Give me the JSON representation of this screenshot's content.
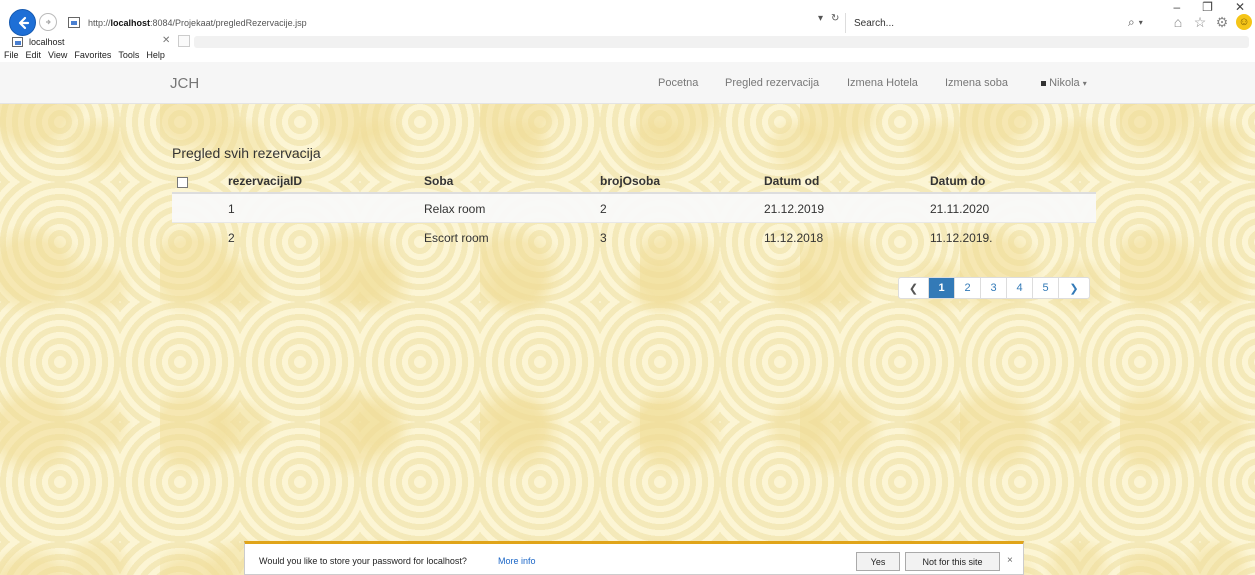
{
  "browser": {
    "url_prefix": "http://",
    "url_host": "localhost",
    "url_path": ":8084/Projekaat/pregledRezervacije.jsp",
    "search_placeholder": "Search...",
    "tab_title": "localhost",
    "menu": [
      "File",
      "Edit",
      "View",
      "Favorites",
      "Tools",
      "Help"
    ]
  },
  "navbar": {
    "brand": "JCH",
    "links": [
      "Pocetna",
      "Pregled rezervacija",
      "Izmena Hotela",
      "Izmena soba"
    ],
    "user": "Nikola"
  },
  "content": {
    "title": "Pregled svih rezervacija",
    "columns": [
      "rezervacijaID",
      "Soba",
      "brojOsoba",
      "Datum od",
      "Datum do"
    ],
    "rows": [
      [
        "1",
        "Relax room",
        "2",
        "21.12.2019",
        "21.11.2020"
      ],
      [
        "2",
        "Escort room",
        "3",
        "11.12.2018",
        "11.12.2019."
      ]
    ]
  },
  "pagination": {
    "pages": [
      "1",
      "2",
      "3",
      "4",
      "5"
    ],
    "active": "1"
  },
  "notification": {
    "message": "Would you like to store your password for localhost?",
    "more_info": "More info",
    "yes": "Yes",
    "no": "Not for this site",
    "close": "×"
  }
}
